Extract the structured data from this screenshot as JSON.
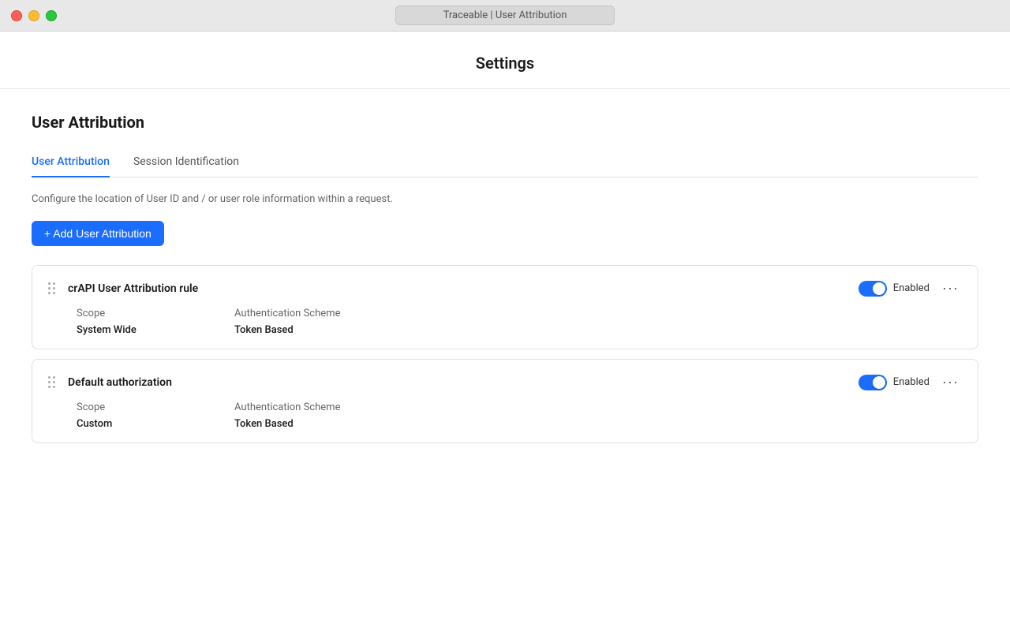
{
  "titleBar": {
    "text": "Traceable | User Attribution"
  },
  "page": {
    "title": "Settings"
  },
  "section": {
    "title": "User Attribution"
  },
  "tabs": [
    {
      "id": "user-attribution",
      "label": "User Attribution",
      "active": true
    },
    {
      "id": "session-identification",
      "label": "Session Identification",
      "active": false
    }
  ],
  "tabDescription": "Configure the location of User ID and / or user role information within a request.",
  "addButton": {
    "label": "+ Add User Attribution"
  },
  "rules": [
    {
      "id": "rule-1",
      "name": "crAPI User Attribution rule",
      "scope": {
        "label": "Scope",
        "value": "System Wide"
      },
      "authScheme": {
        "label": "Authentication Scheme",
        "value": "Token Based"
      },
      "enabled": true,
      "enabledLabel": "Enabled"
    },
    {
      "id": "rule-2",
      "name": "Default authorization",
      "scope": {
        "label": "Scope",
        "value": "Custom"
      },
      "authScheme": {
        "label": "Authentication Scheme",
        "value": "Token Based"
      },
      "enabled": true,
      "enabledLabel": "Enabled"
    }
  ],
  "colors": {
    "accent": "#1a6dff",
    "toggleEnabled": "#1a6dff"
  }
}
